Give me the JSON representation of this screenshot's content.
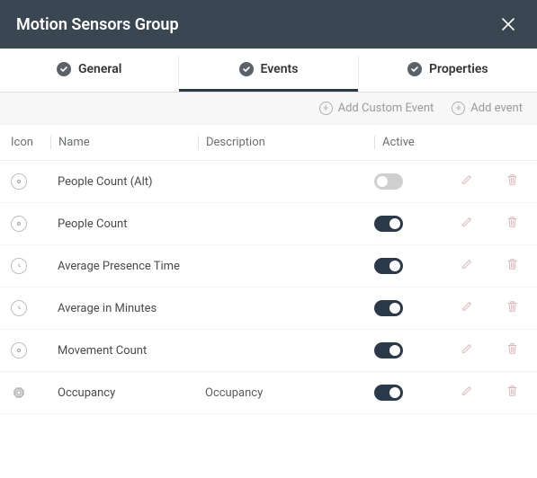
{
  "title": "Motion Sensors Group",
  "tabs": {
    "general": "General",
    "events": "Events",
    "properties": "Properties",
    "active": "events"
  },
  "toolbar": {
    "add_custom_event": "Add Custom Event",
    "add_event": "Add event"
  },
  "columns": {
    "icon": "Icon",
    "name": "Name",
    "description": "Description",
    "active": "Active"
  },
  "rows": [
    {
      "icon": "eye",
      "name": "People Count (Alt)",
      "description": "",
      "active": false
    },
    {
      "icon": "eye",
      "name": "People Count",
      "description": "",
      "active": true
    },
    {
      "icon": "clock",
      "name": "Average Presence Time",
      "description": "",
      "active": true
    },
    {
      "icon": "clock",
      "name": "Average in Minutes",
      "description": "",
      "active": true
    },
    {
      "icon": "eye",
      "name": "Movement Count",
      "description": "",
      "active": true
    },
    {
      "icon": "chip",
      "name": "Occupancy",
      "description": "Occupancy",
      "active": true
    }
  ]
}
